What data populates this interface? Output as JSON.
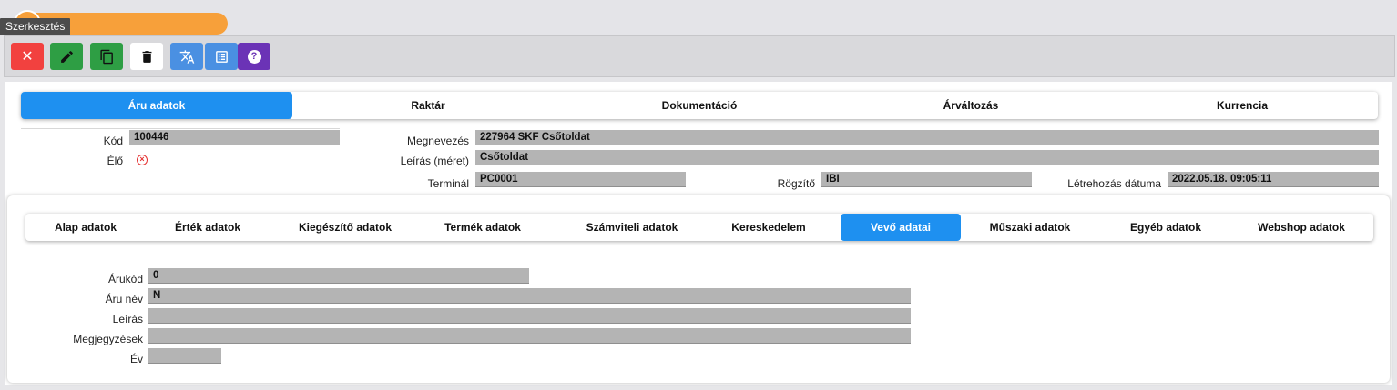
{
  "tooltip": "Szerkesztés",
  "toolbar": [
    {
      "name": "close-button",
      "icon": "close-icon",
      "glyph": "✕",
      "color": "#f2413f"
    },
    {
      "name": "edit-button",
      "icon": "pencil-icon",
      "glyph": "",
      "color": "#2e9e44"
    },
    {
      "name": "copy-button",
      "icon": "copy-icon",
      "glyph": "",
      "color": "#2e9e44"
    },
    {
      "name": "delete-button",
      "icon": "trash-icon",
      "glyph": "",
      "color": "#ffffff"
    },
    {
      "name": "translate-button",
      "icon": "translate-icon",
      "glyph": "",
      "color": "#4a90e2"
    },
    {
      "name": "list-button",
      "icon": "list-icon",
      "glyph": "",
      "color": "#4a90e2"
    },
    {
      "name": "help-button",
      "icon": "help-icon",
      "glyph": "?",
      "color": "#6b33b6"
    }
  ],
  "main_tabs": [
    "Áru adatok",
    "Raktár",
    "Dokumentáció",
    "Árváltozás",
    "Kurrencia"
  ],
  "header": {
    "kod_label": "Kód",
    "kod_value": "100446",
    "elo_label": "Élő",
    "megnevezes_label": "Megnevezés",
    "megnevezes_value": "227964 SKF Csőtoldat",
    "leiras_label": "Leírás (méret)",
    "leiras_value": "Csőtoldat",
    "terminal_label": "Terminál",
    "terminal_value": "PC0001",
    "rogzito_label": "Rögzítő",
    "rogzito_value": "IBI",
    "letrehozas_label": "Létrehozás dátuma",
    "letrehozas_value": "2022.05.18. 09:05:11"
  },
  "sub_tabs": [
    "Alap adatok",
    "Érték adatok",
    "Kiegészítő adatok",
    "Termék adatok",
    "Számviteli adatok",
    "Kereskedelem",
    "Vevő adatai",
    "Műszaki adatok",
    "Egyéb adatok",
    "Webshop adatok"
  ],
  "vevo": {
    "arukod_label": "Árukód",
    "arukod_value": "0",
    "aru_nev_label": "Áru név",
    "aru_nev_value": "N",
    "leiras_label": "Leírás",
    "leiras_value": "",
    "megjegyzesek_label": "Megjegyzések",
    "megjegyzesek_value": "",
    "ev_label": "Év",
    "ev_value": ""
  },
  "colors": {
    "accent": "#1e90f0",
    "orange": "#f7a03a",
    "alive_off": "#e53030"
  }
}
